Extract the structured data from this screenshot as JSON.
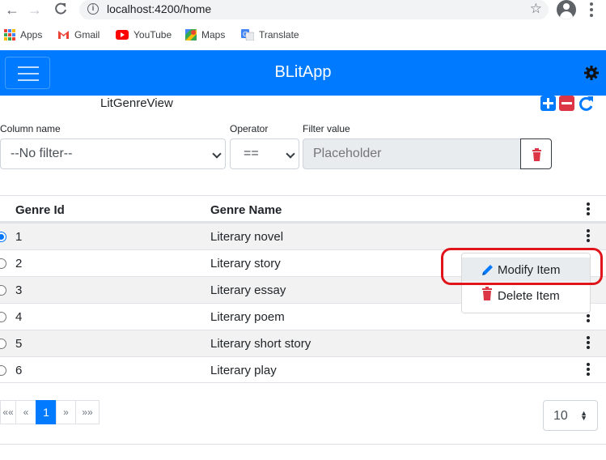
{
  "browser": {
    "url": "localhost:4200/home",
    "bookmarks": [
      {
        "label": "Apps",
        "icon": "apps-grid-icon"
      },
      {
        "label": "Gmail",
        "icon": "gmail-icon"
      },
      {
        "label": "YouTube",
        "icon": "youtube-icon"
      },
      {
        "label": "Maps",
        "icon": "maps-icon"
      },
      {
        "label": "Translate",
        "icon": "translate-icon"
      }
    ]
  },
  "navbar": {
    "brand": "BLitApp",
    "color": "#007bff"
  },
  "view": {
    "title": "LitGenreView",
    "filter": {
      "column_label": "Column name",
      "column_value": "--No filter--",
      "operator_label": "Operator",
      "operator_value": "==",
      "value_label": "Filter value",
      "value_placeholder": "Placeholder"
    },
    "table": {
      "headers": [
        "Genre Id",
        "Genre Name"
      ],
      "rows": [
        {
          "id": "1",
          "name": "Literary novel",
          "selected": true
        },
        {
          "id": "2",
          "name": "Literary story",
          "selected": false
        },
        {
          "id": "3",
          "name": "Literary essay",
          "selected": false
        },
        {
          "id": "4",
          "name": "Literary poem",
          "selected": false
        },
        {
          "id": "5",
          "name": "Literary short story",
          "selected": false
        },
        {
          "id": "6",
          "name": "Literary play",
          "selected": false
        }
      ]
    },
    "context_menu": {
      "items": [
        {
          "label": "Modify Item",
          "icon": "pencil-icon"
        },
        {
          "label": "Delete Item",
          "icon": "trash-icon"
        }
      ]
    },
    "pager": {
      "first": "««",
      "prev": "«",
      "current": "1",
      "next": "»",
      "last": "»»",
      "page_size": "10"
    }
  }
}
